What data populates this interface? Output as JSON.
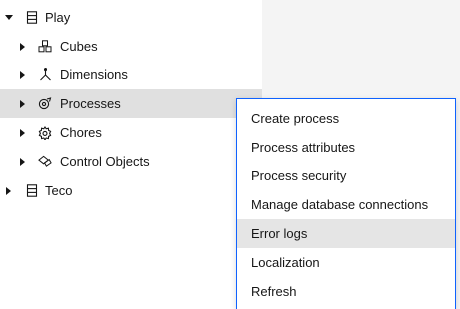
{
  "tree": {
    "items": [
      {
        "label": "Play",
        "expanded": true,
        "icon": "database-icon"
      },
      {
        "label": "Cubes",
        "icon": "cubes-icon"
      },
      {
        "label": "Dimensions",
        "icon": "dimensions-icon"
      },
      {
        "label": "Processes",
        "icon": "processes-icon",
        "selected": true
      },
      {
        "label": "Chores",
        "icon": "chores-icon"
      },
      {
        "label": "Control Objects",
        "icon": "control-objects-icon"
      },
      {
        "label": "Teco",
        "expanded": false,
        "icon": "database-icon"
      }
    ]
  },
  "context_menu": {
    "items": [
      {
        "label": "Create process"
      },
      {
        "label": "Process attributes"
      },
      {
        "label": "Process security"
      },
      {
        "label": "Manage database connections"
      },
      {
        "label": "Error logs",
        "hovered": true
      },
      {
        "label": "Localization"
      },
      {
        "label": "Refresh"
      }
    ]
  },
  "colors": {
    "menu_border": "#0f62fe",
    "selected_row": "#e0e0e0",
    "hover_item": "#e5e5e5",
    "side_panel": "#f4f4f4"
  }
}
